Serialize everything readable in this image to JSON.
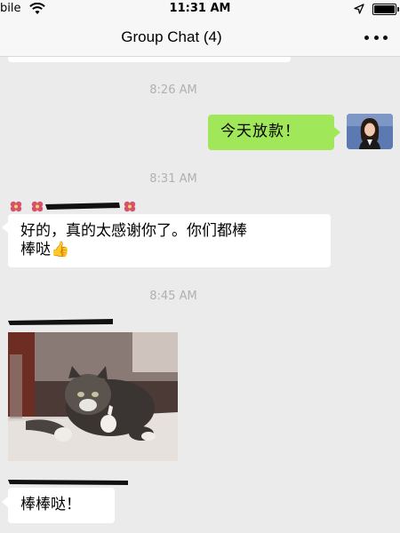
{
  "status_bar": {
    "carrier": "bile",
    "time": "11:31 AM",
    "icons": [
      "wifi-icon",
      "location-arrow-icon",
      "battery-icon"
    ]
  },
  "nav": {
    "title": "Group Chat (4)",
    "more_icon": "more-dots-icon"
  },
  "timestamps": [
    "8:26 AM",
    "8:31 AM",
    "8:45 AM"
  ],
  "messages": [
    {
      "side": "right",
      "text": "今天放款！"
    },
    {
      "side": "left",
      "lines": [
        "好的，真的太感谢你了。你们都棒",
        "棒哒"
      ],
      "emoji": "👍"
    },
    {
      "side": "left",
      "type": "image",
      "description_icon": "cat-thumbs-up-photo"
    },
    {
      "side": "left",
      "text": "棒棒哒！"
    }
  ],
  "colors": {
    "background": "#ebebeb",
    "bar": "#f7f7f7",
    "outgoing_bubble": "#a0e75a",
    "incoming_bubble": "#ffffff",
    "timestamp": "#b0b0b0"
  }
}
